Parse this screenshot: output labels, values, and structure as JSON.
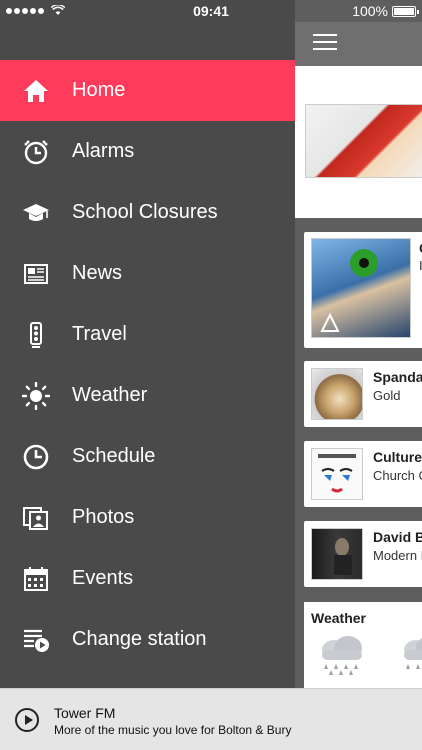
{
  "status_bar": {
    "time": "09:41",
    "battery": "100%"
  },
  "drawer": {
    "items": [
      {
        "label": "Home",
        "icon": "home-icon",
        "active": true
      },
      {
        "label": "Alarms",
        "icon": "alarm-clock-icon"
      },
      {
        "label": "School Closures",
        "icon": "graduation-cap-icon"
      },
      {
        "label": "News",
        "icon": "newspaper-icon"
      },
      {
        "label": "Travel",
        "icon": "traffic-light-icon"
      },
      {
        "label": "Weather",
        "icon": "sun-icon"
      },
      {
        "label": "Schedule",
        "icon": "clock-icon"
      },
      {
        "label": "Photos",
        "icon": "photos-icon"
      },
      {
        "label": "Events",
        "icon": "calendar-icon"
      },
      {
        "label": "Change station",
        "icon": "playlist-play-icon"
      }
    ]
  },
  "tracks": [
    {
      "artist": "C",
      "title": "I"
    },
    {
      "artist": "Spanda",
      "title": "Gold"
    },
    {
      "artist": "Culture",
      "title": "Church C"
    },
    {
      "artist": "David B",
      "title": "Modern L"
    }
  ],
  "weather_card": {
    "title": "Weather"
  },
  "player": {
    "station": "Tower FM",
    "tagline": "More of the music you love for Bolton & Bury"
  },
  "colors": {
    "accent": "#ff3b5c",
    "drawer_bg": "#4a4a4a"
  }
}
